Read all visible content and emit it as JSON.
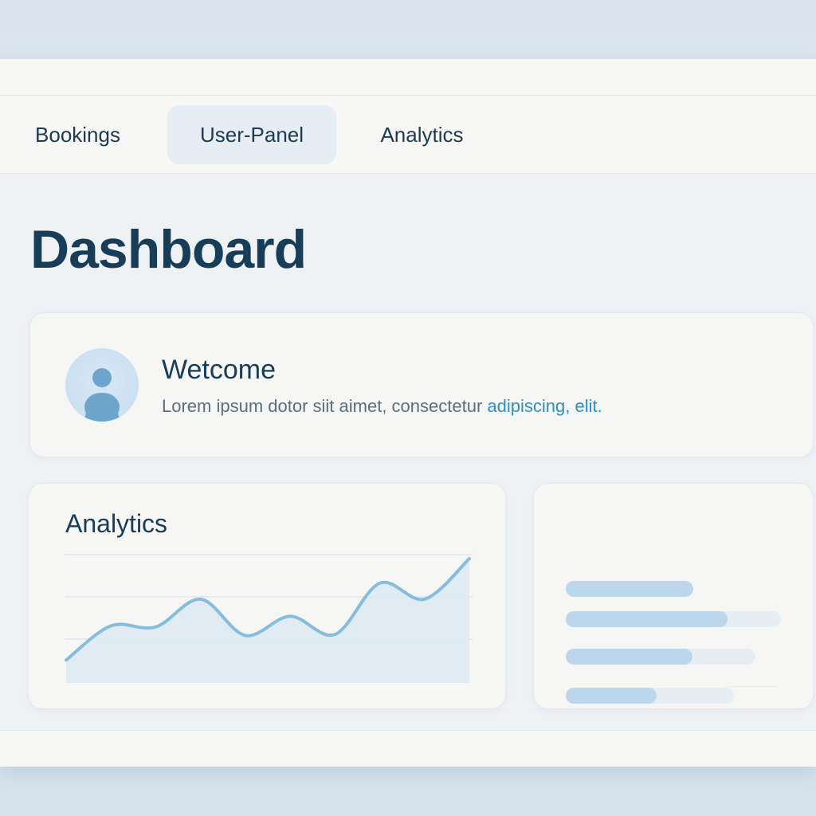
{
  "nav": {
    "tabs": [
      {
        "label": "Bookings"
      },
      {
        "label": "User-Panel",
        "active": true
      },
      {
        "label": "Analytics"
      }
    ]
  },
  "page_title": "Dashboard",
  "welcome": {
    "title": "Wetcome",
    "text": "Lorem ipsum dotor siit aimet, consectetur ",
    "link": "adipiscing, elit."
  },
  "analytics": {
    "title": "Analytics",
    "chart_data": {
      "type": "area",
      "values": [
        5,
        37,
        36,
        62,
        28,
        46,
        29,
        77,
        62,
        100
      ],
      "ylim": [
        0,
        100
      ],
      "grid": true
    }
  },
  "stats": {
    "bars": [
      {
        "fill": 1.0
      },
      {
        "fill": 0.75
      },
      {
        "fill": 0.67
      },
      {
        "fill": 0.54
      }
    ]
  },
  "colors": {
    "accent": "#2b8fc4",
    "chart_line": "#86bddf",
    "chart_fill": "#dde9f3",
    "title": "#173d58"
  }
}
